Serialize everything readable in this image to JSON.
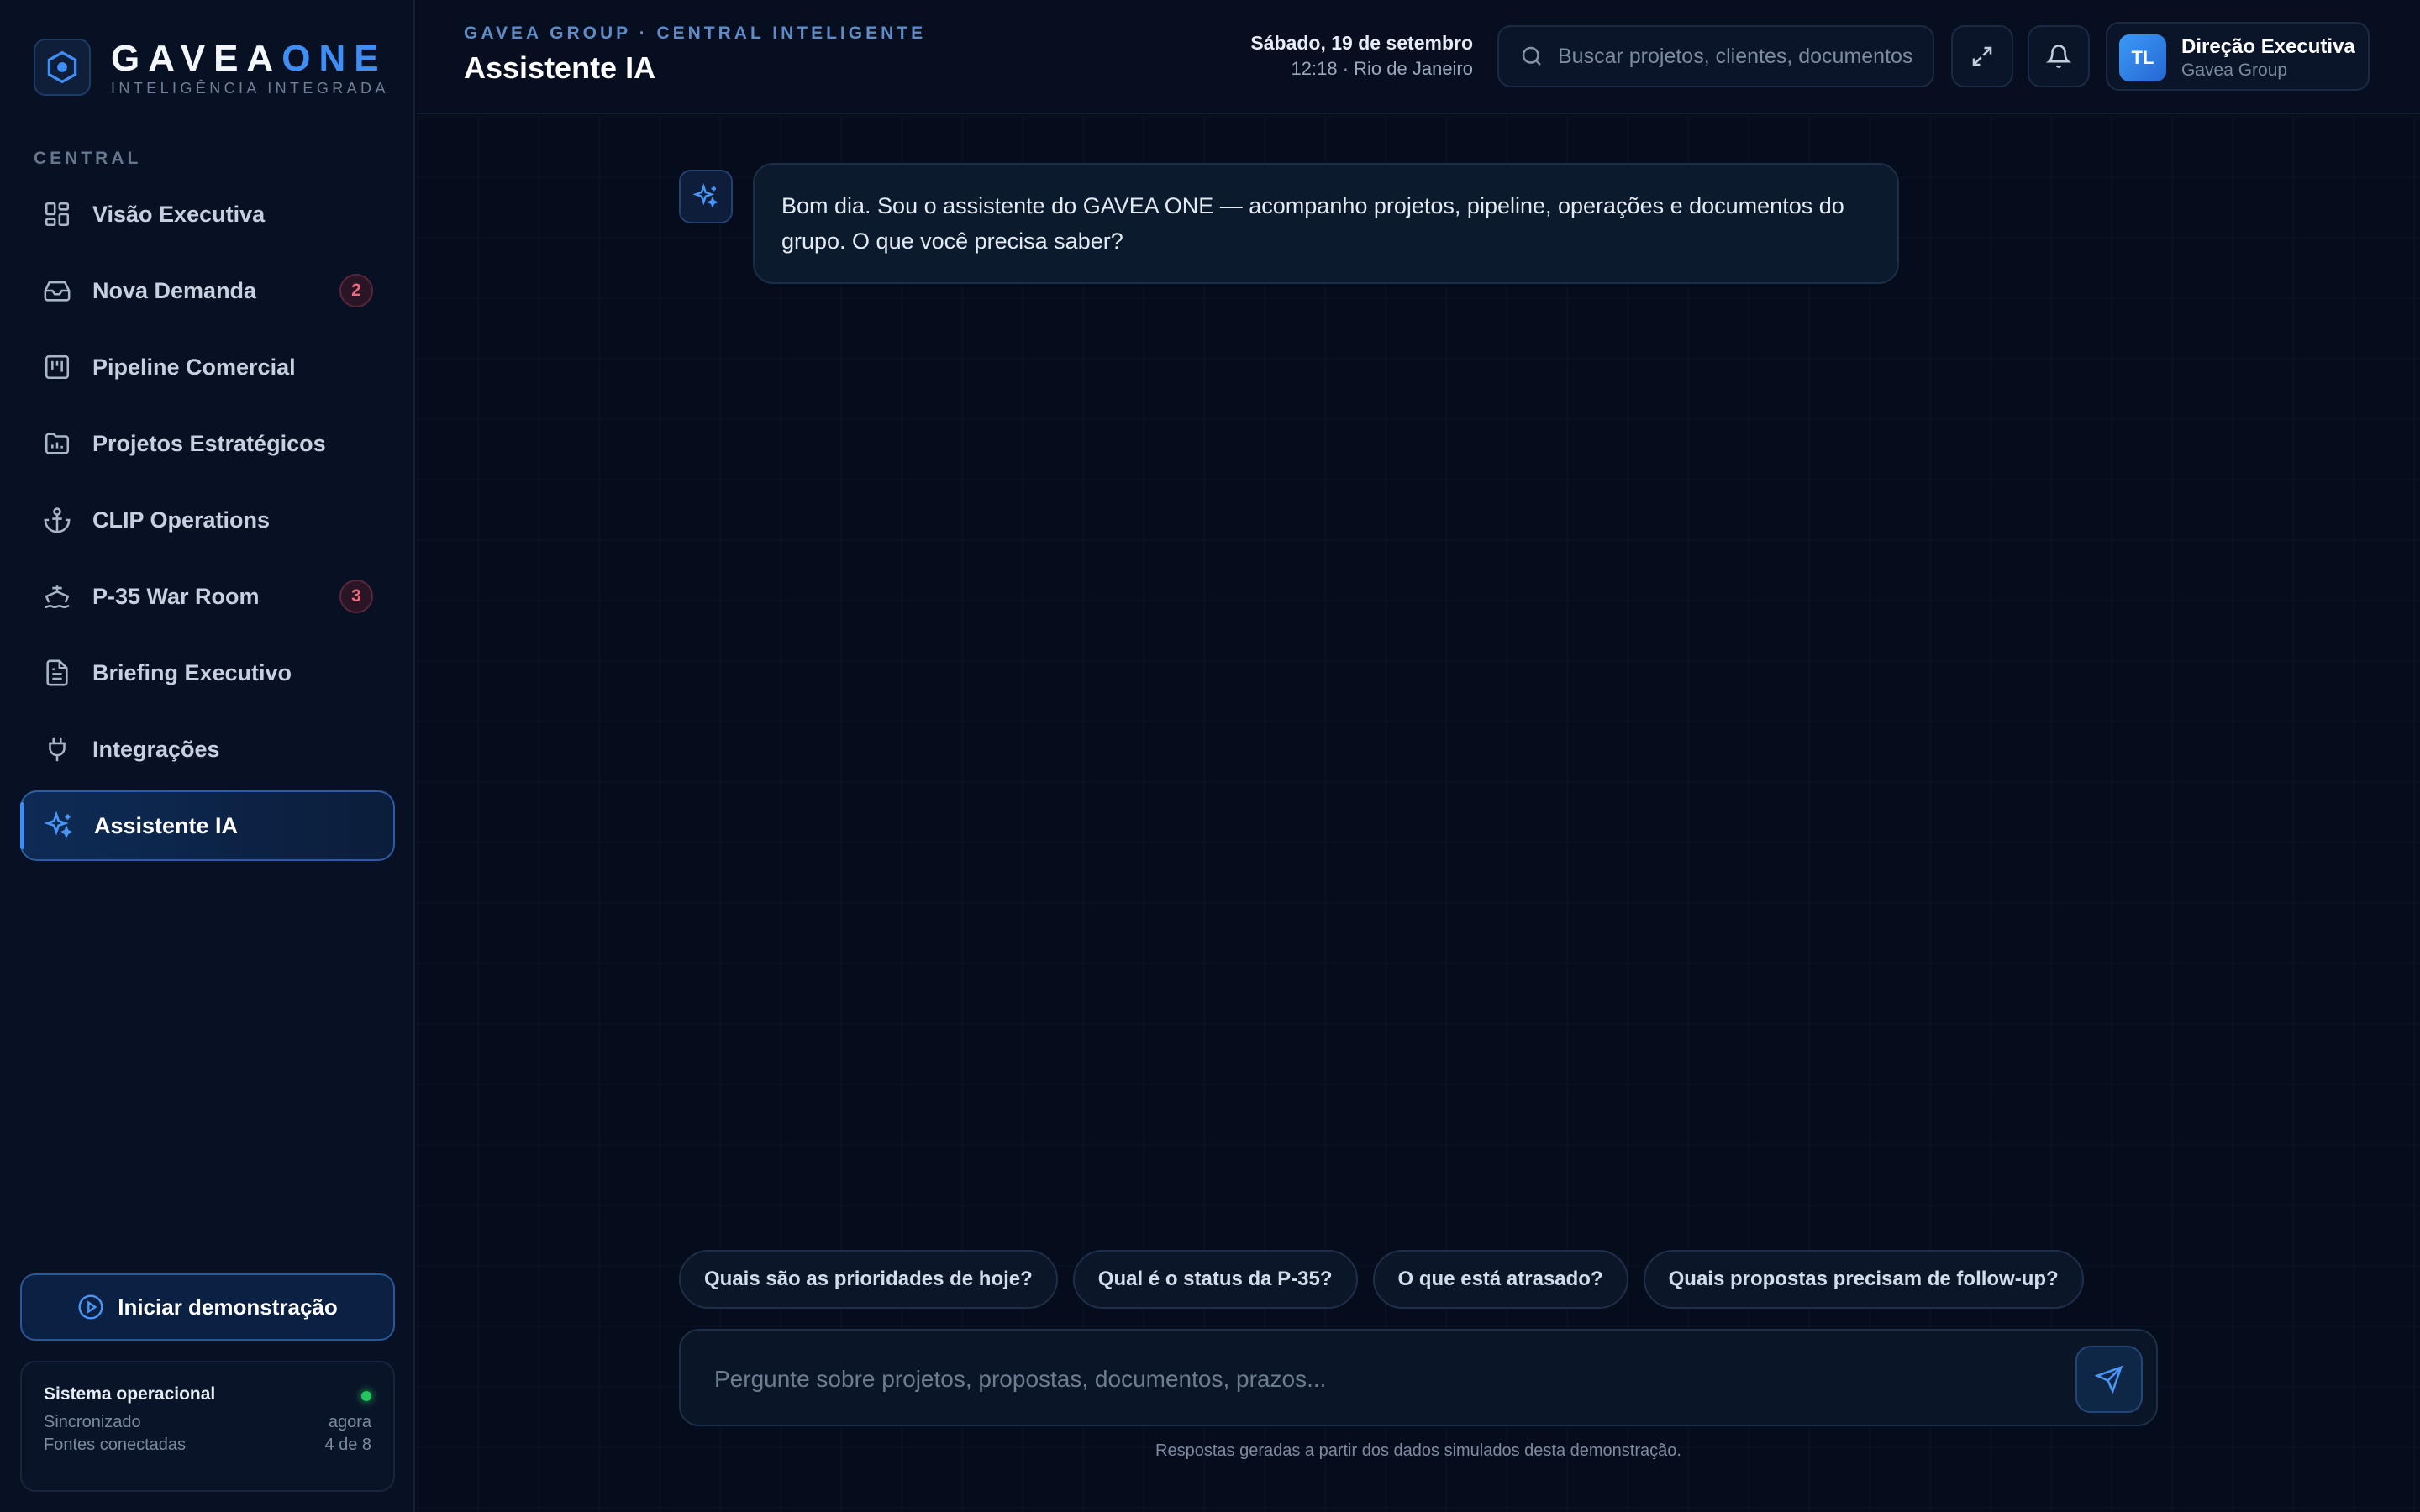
{
  "brand": {
    "name_part1": "GAVEA",
    "name_part2": "ONE",
    "tagline": "INTELIGÊNCIA INTEGRADA"
  },
  "sidebar": {
    "section_label": "CENTRAL",
    "items": [
      {
        "label": "Visão Executiva",
        "icon": "grid-icon"
      },
      {
        "label": "Nova Demanda",
        "icon": "inbox-icon",
        "badge": "2"
      },
      {
        "label": "Pipeline Comercial",
        "icon": "kanban-icon"
      },
      {
        "label": "Projetos Estratégicos",
        "icon": "folder-chart-icon"
      },
      {
        "label": "CLIP Operations",
        "icon": "anchor-icon"
      },
      {
        "label": "P-35 War Room",
        "icon": "ship-icon",
        "badge": "3"
      },
      {
        "label": "Briefing Executivo",
        "icon": "document-icon"
      },
      {
        "label": "Integrações",
        "icon": "plug-icon"
      },
      {
        "label": "Assistente IA",
        "icon": "sparkles-icon",
        "active": true
      }
    ],
    "demo_button": "Iniciar demonstração",
    "status": {
      "title": "Sistema operacional",
      "sync_label": "Sincronizado",
      "sync_value": "agora",
      "sources_label": "Fontes conectadas",
      "sources_value": "4 de 8"
    }
  },
  "header": {
    "breadcrumb": "GAVEA GROUP · CENTRAL INTELIGENTE",
    "title": "Assistente IA",
    "date": "Sábado, 19 de setembro",
    "time": "12:18 · Rio de Janeiro",
    "search_placeholder": "Buscar projetos, clientes, documentos",
    "user": {
      "initials": "TL",
      "name": "Direção Executiva",
      "org": "Gavea Group"
    }
  },
  "chat": {
    "messages": [
      {
        "role": "assistant",
        "text": "Bom dia. Sou o assistente do GAVEA ONE — acompanho projetos, pipeline, operações e documentos do grupo. O que você precisa saber?"
      }
    ],
    "suggestions": [
      "Quais são as prioridades de hoje?",
      "Qual é o status da P-35?",
      "O que está atrasado?",
      "Quais propostas precisam de follow-up?"
    ],
    "input_placeholder": "Pergunte sobre projetos, propostas, documentos, prazos...",
    "disclaimer": "Respostas geradas a partir dos dados simulados desta demonstração."
  },
  "colors": {
    "accent": "#3f8ef5",
    "background": "#050c1c",
    "badge": "#f06a7e",
    "status_ok": "#22c55e"
  }
}
